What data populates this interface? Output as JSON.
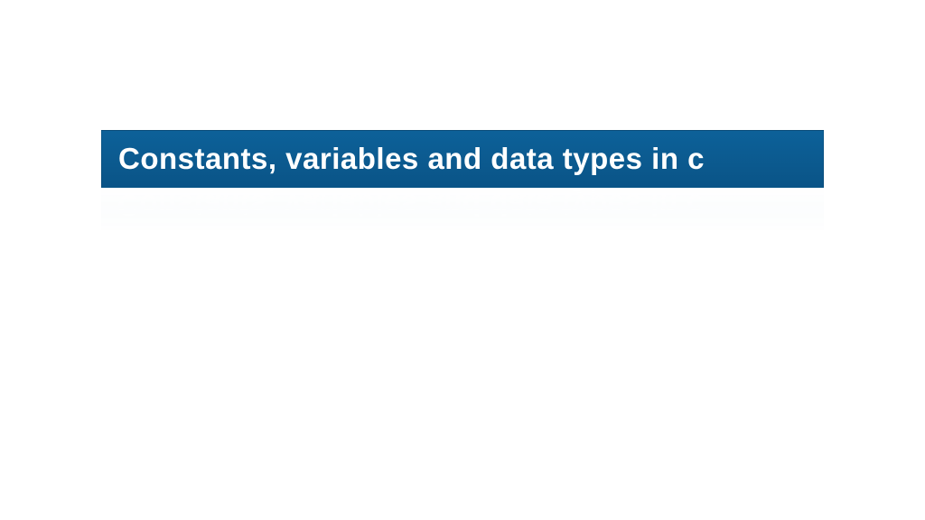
{
  "slide": {
    "title": "Constants, variables and data types in c",
    "banner_color": "#0b5a8e",
    "text_color": "#ffffff"
  }
}
